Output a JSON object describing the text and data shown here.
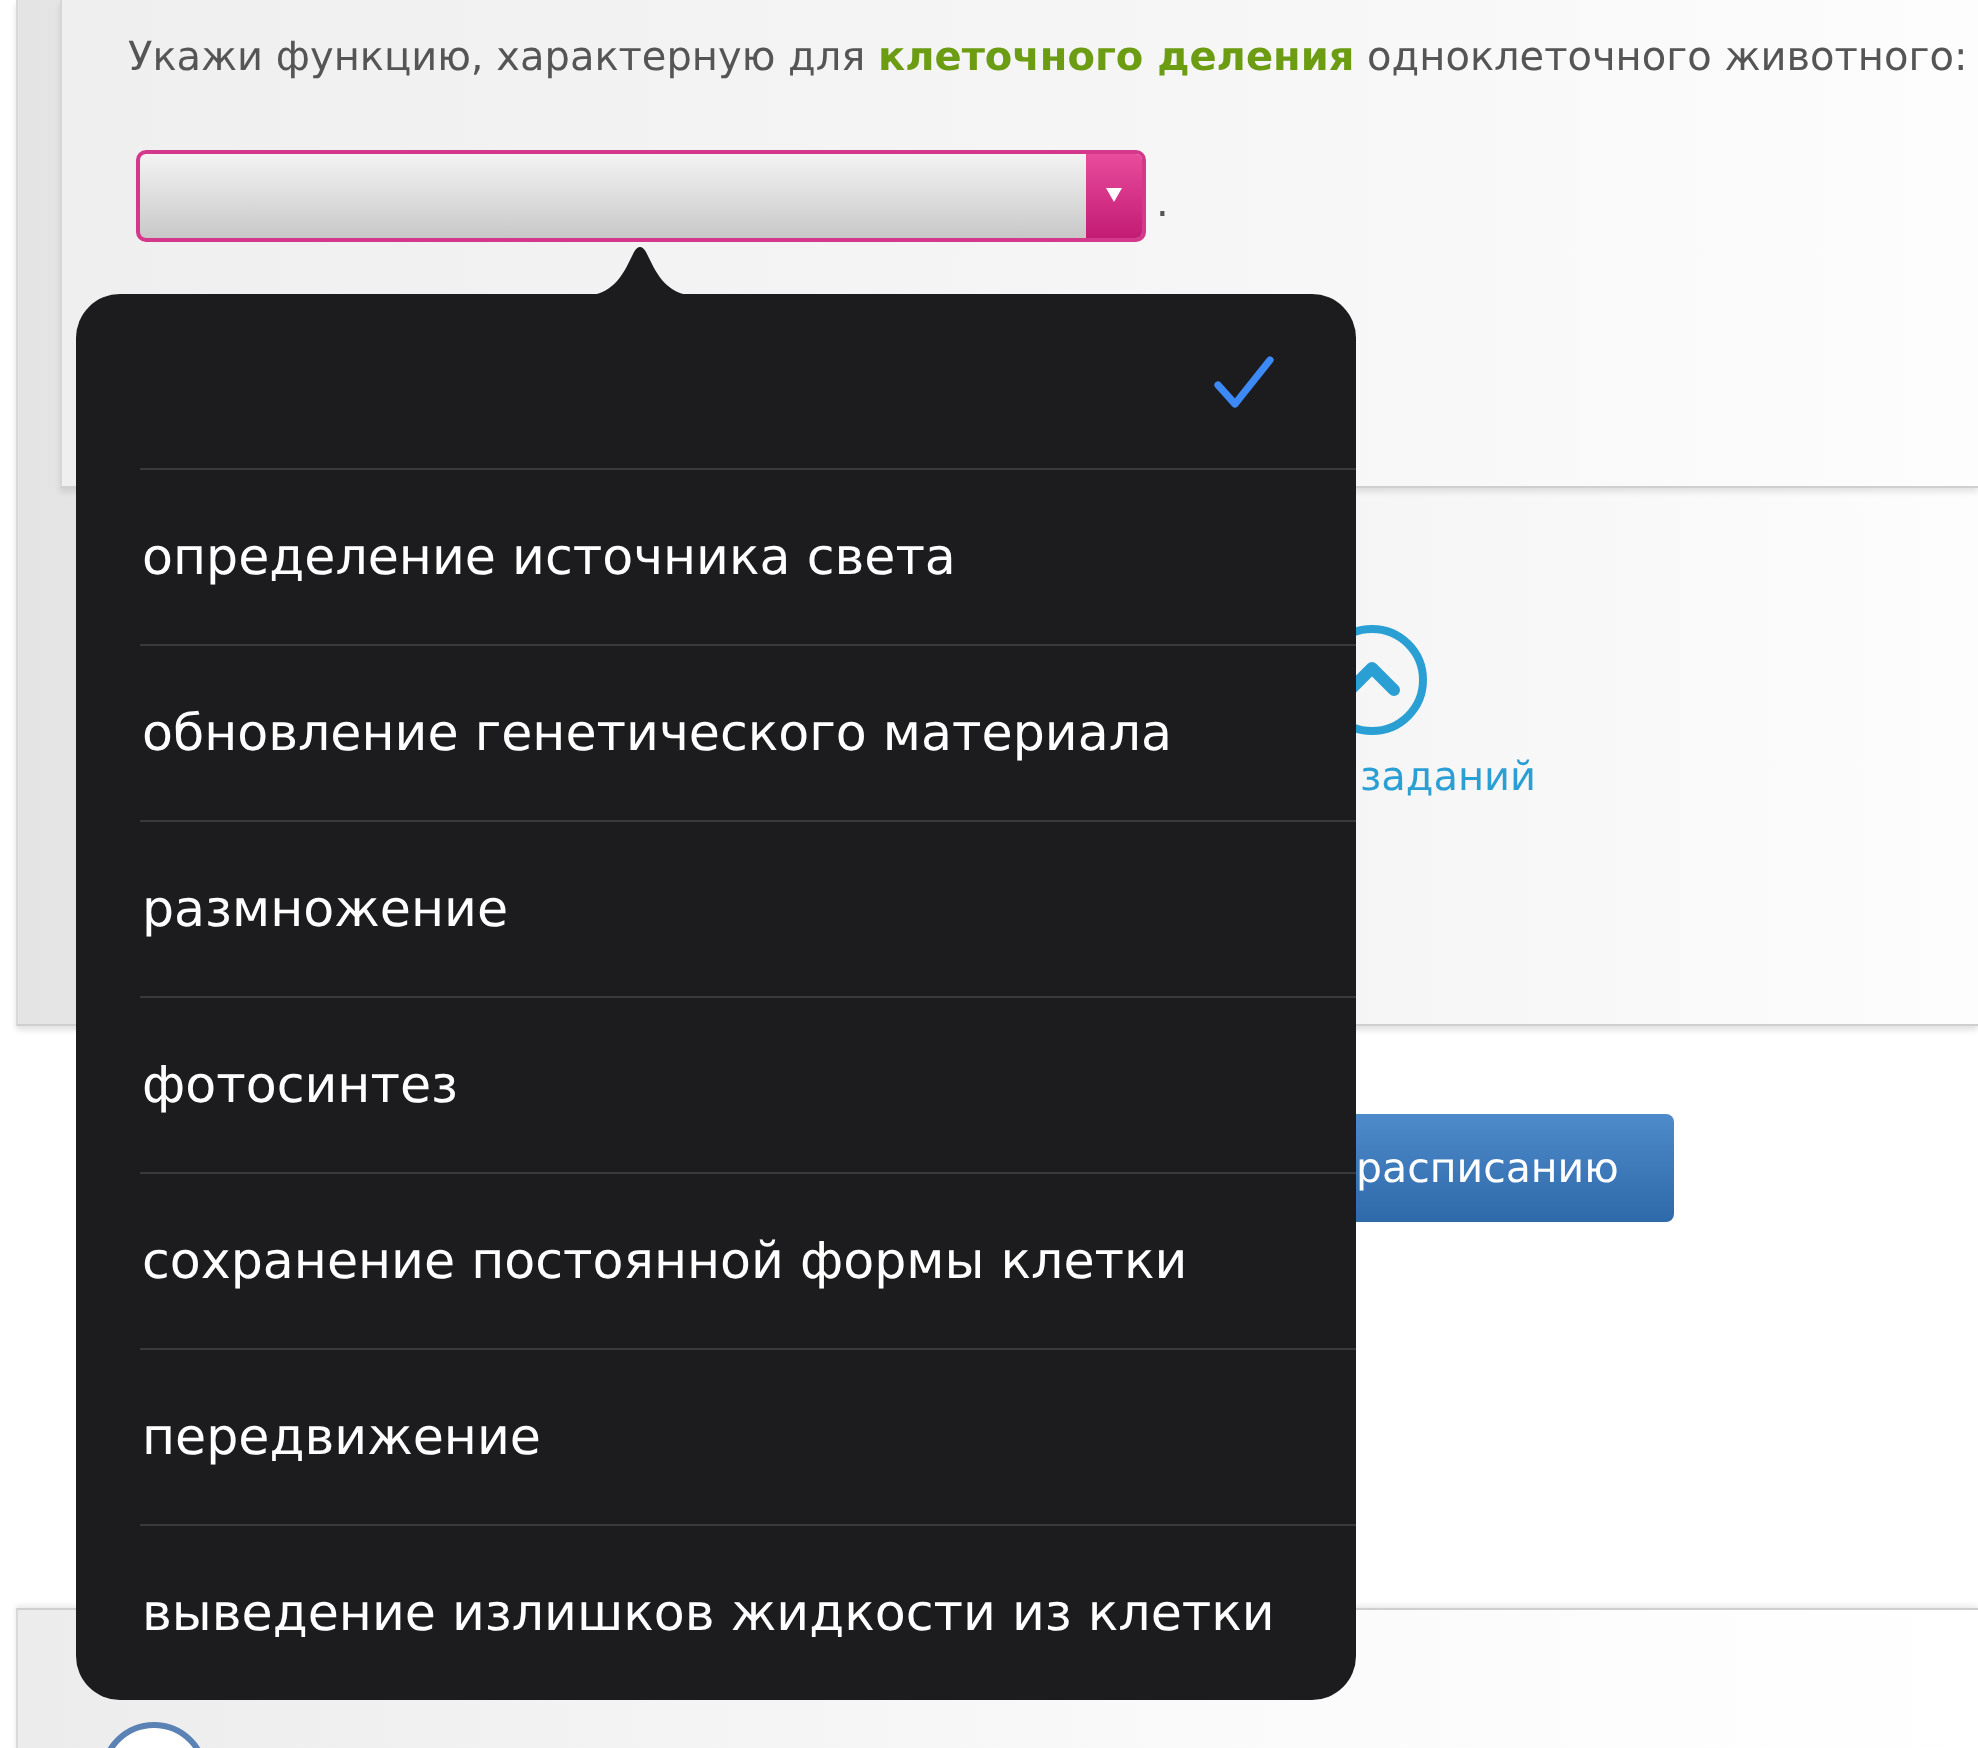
{
  "question": {
    "text": "Укажи функцию, характерную для **клеточного деления** одноклеточного животного:"
  },
  "select": {
    "open": true,
    "after": ".",
    "options": [
      {
        "selected": true
      },
      {
        "label": "определение источника света",
        "selected": false
      },
      {
        "label": "обновление генетического материала",
        "selected": false
      },
      {
        "label": "размножение",
        "selected": false
      },
      {
        "label": "фотосинтез",
        "selected": false
      },
      {
        "label": "сохранение постоянной формы клетки",
        "selected": false
      },
      {
        "label": "передвижение",
        "selected": false
      },
      {
        "label": "выведение излишков жидкости из клетки",
        "selected": false
      }
    ]
  },
  "link": {
    "label": "заданий"
  },
  "button": {
    "label": "расписанию"
  }
}
